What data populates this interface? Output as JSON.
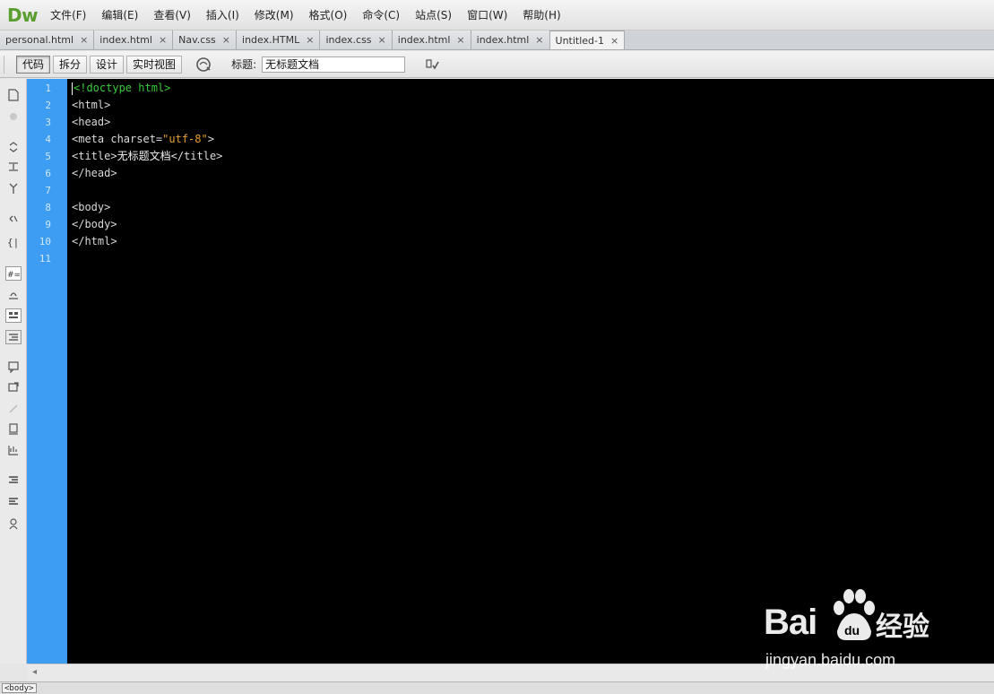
{
  "app": {
    "logo": "Dw"
  },
  "menu": [
    "文件(F)",
    "编辑(E)",
    "查看(V)",
    "插入(I)",
    "修改(M)",
    "格式(O)",
    "命令(C)",
    "站点(S)",
    "窗口(W)",
    "帮助(H)"
  ],
  "tabs": [
    {
      "label": "personal.html",
      "close": "×"
    },
    {
      "label": "index.html",
      "close": "×"
    },
    {
      "label": "Nav.css",
      "close": "×"
    },
    {
      "label": "index.HTML",
      "close": "×"
    },
    {
      "label": "index.css",
      "close": "×"
    },
    {
      "label": "index.html",
      "close": "×"
    },
    {
      "label": "index.html",
      "close": "×"
    },
    {
      "label": "Untitled-1",
      "close": "×",
      "active": true
    }
  ],
  "doc_toolbar": {
    "views": [
      "代码",
      "拆分",
      "设计",
      "实时视图"
    ],
    "selected_view": "代码",
    "title_label": "标题:",
    "title_value": "无标题文档"
  },
  "tools": [
    "collapse-full-tag-icon",
    "collapse-selection-icon",
    "expand-all-icon",
    "select-parent-tag-icon",
    "balance-braces-icon",
    "line-numbers-icon",
    "highlight-invalid-code-icon",
    "syntax-coloring-icon",
    "auto-indent-icon",
    "apply-comment-icon",
    "remove-comment-icon",
    "wrap-tag-icon",
    "recent-snippets-icon",
    "move-css-icon",
    "indent-code-icon",
    "outdent-code-icon",
    "format-source-code-icon"
  ],
  "line_numbers": [
    "1",
    "2",
    "3",
    "4",
    "5",
    "6",
    "7",
    "8",
    "9",
    "10",
    "11"
  ],
  "code": {
    "l1": "<!doctype html>",
    "l2": "<html>",
    "l3": "<head>",
    "l4a": "<meta charset=",
    "l4b": "\"utf-8\"",
    "l4c": ">",
    "l5a": "<title>",
    "l5b": "无标题文档",
    "l5c": "</title>",
    "l6": "</head>",
    "l8": "<body>",
    "l9": "</body>",
    "l10": "</html>"
  },
  "status": {
    "tag_selector": "<body>",
    "scroll_left": "◂"
  },
  "watermark": {
    "brand_a": "Bai",
    "brand_b": "经验",
    "url": "jingyan.baidu.com"
  },
  "colors": {
    "gutter": "#3d9df2",
    "editor_bg": "#000000",
    "doctype": "#38c93b",
    "string": "#e6a02a",
    "logo": "#5a9e2f"
  }
}
